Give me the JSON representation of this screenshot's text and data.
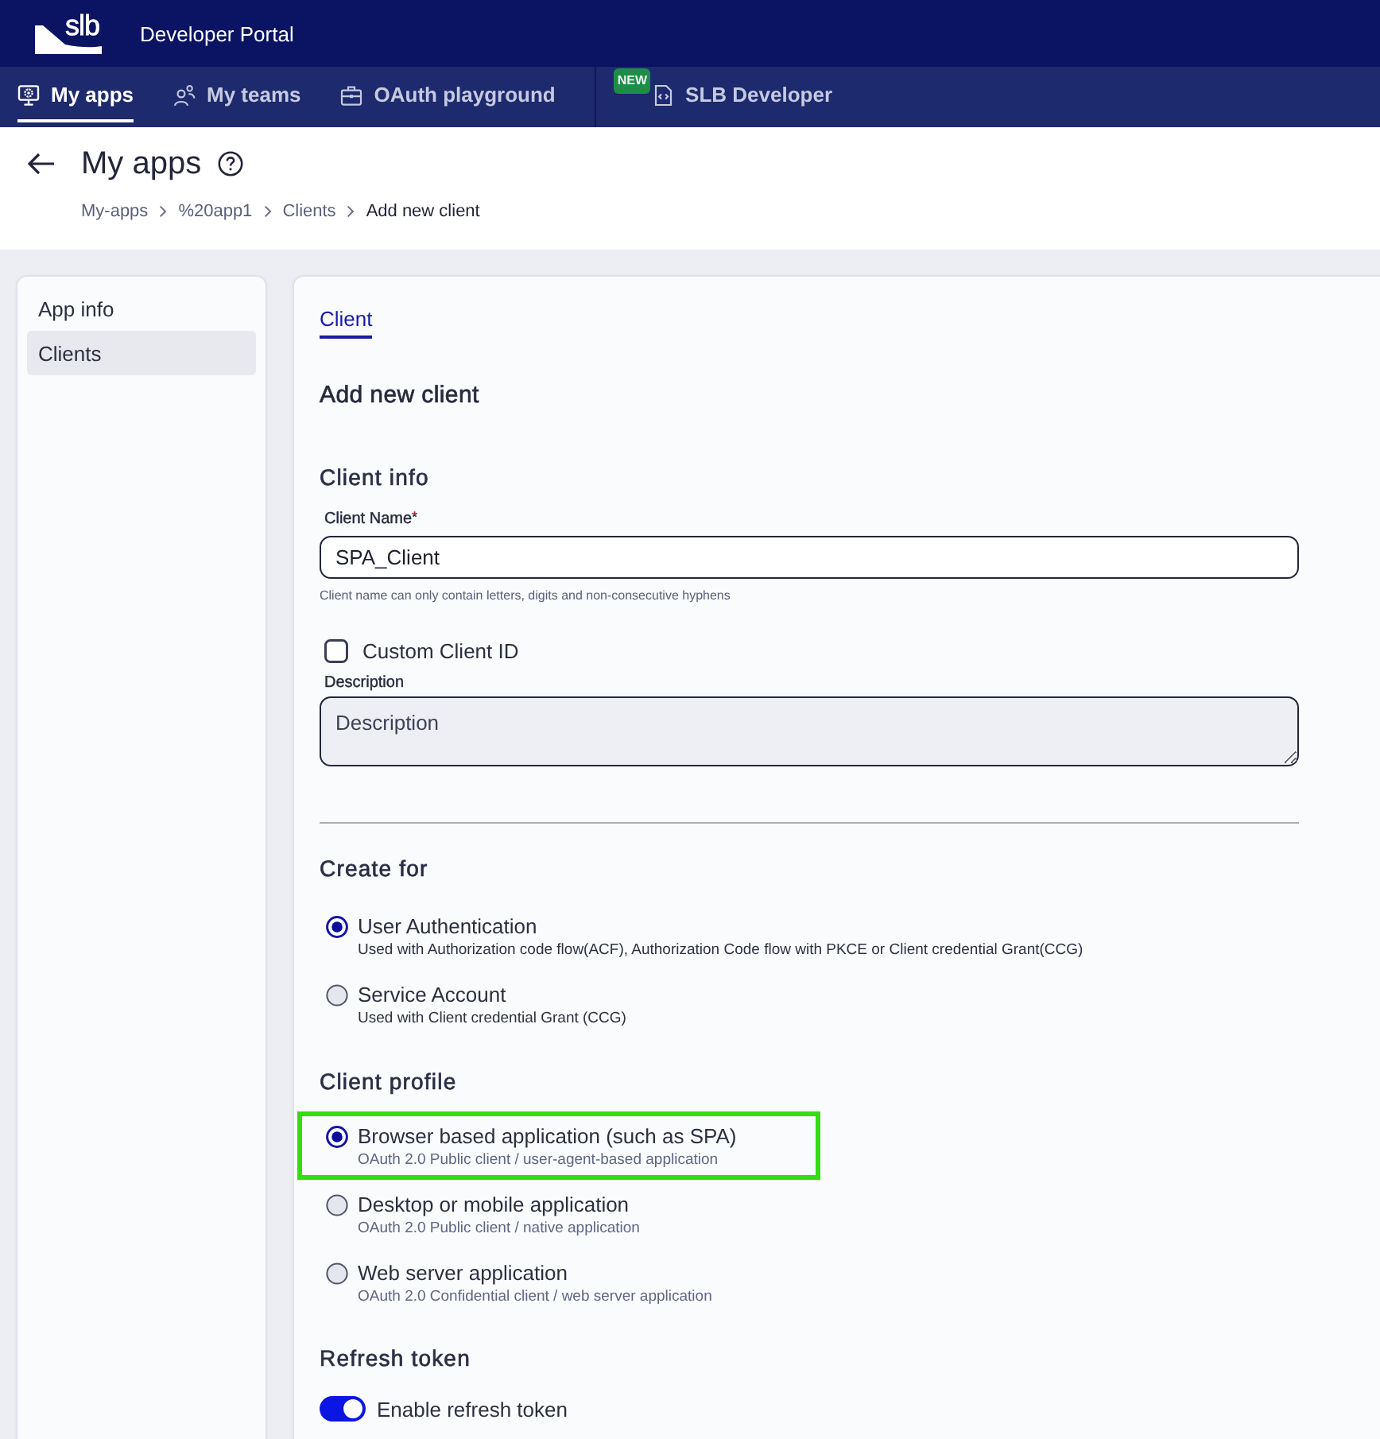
{
  "header": {
    "logo_text": "slb",
    "title": "Developer Portal"
  },
  "nav": {
    "tabs": [
      {
        "label": "My apps",
        "selected": true
      },
      {
        "label": "My teams",
        "selected": false
      },
      {
        "label": "OAuth playground",
        "selected": false
      }
    ],
    "external": {
      "label": "SLB Developer",
      "badge": "NEW"
    }
  },
  "page_header": {
    "title": "My apps",
    "breadcrumb": [
      {
        "label": "My-apps",
        "current": false
      },
      {
        "label": "%20app1",
        "current": false
      },
      {
        "label": "Clients",
        "current": false
      },
      {
        "label": "Add new client",
        "current": true
      }
    ]
  },
  "sidebar": {
    "items": [
      {
        "label": "App info",
        "selected": false
      },
      {
        "label": "Clients",
        "selected": true
      }
    ]
  },
  "form": {
    "tabs": [
      {
        "label": "Client",
        "selected": true
      }
    ],
    "title": "Add new client",
    "client_info": {
      "heading": "Client info",
      "name_field": {
        "label": "Client Name",
        "required_mark": "*",
        "value": "SPA_Client",
        "hint": "Client name can only contain letters, digits and non-consecutive hyphens"
      },
      "custom_id": {
        "label": "Custom Client ID",
        "checked": false
      },
      "description": {
        "label": "Description",
        "placeholder": "Description"
      }
    },
    "create_for": {
      "heading": "Create for",
      "options": [
        {
          "label": "User Authentication",
          "description": "Used with Authorization code flow(ACF), Authorization Code flow with PKCE or Client credential Grant(CCG)",
          "selected": true
        },
        {
          "label": "Service Account",
          "description": "Used with Client credential Grant (CCG)",
          "selected": false
        }
      ]
    },
    "client_profile": {
      "heading": "Client profile",
      "options": [
        {
          "label": "Browser based application (such as SPA)",
          "description": "OAuth 2.0 Public client / user-agent-based application",
          "selected": true,
          "highlighted": true
        },
        {
          "label": "Desktop or mobile application",
          "description": "OAuth 2.0 Public client / native application",
          "selected": false,
          "highlighted": false
        },
        {
          "label": "Web server application",
          "description": "OAuth 2.0 Confidential client / web server application",
          "selected": false,
          "highlighted": false
        }
      ]
    },
    "refresh_token": {
      "heading": "Refresh token",
      "toggle": {
        "label": "Enable refresh token",
        "on": true
      }
    }
  }
}
